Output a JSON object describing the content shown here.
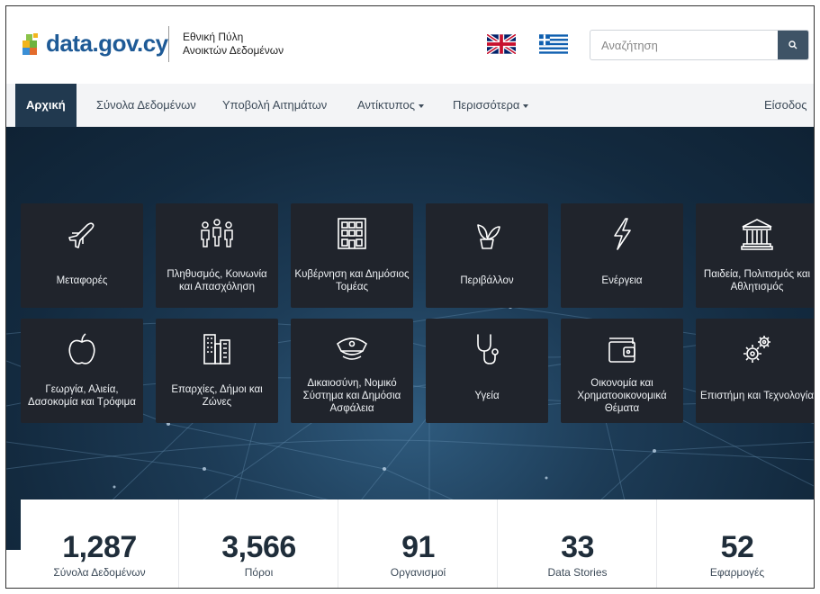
{
  "header": {
    "logo_text": "data.gov.cy",
    "subtitle_line1": "Εθνική Πύλη",
    "subtitle_line2": "Ανοικτών Δεδομένων",
    "search_placeholder": "Αναζήτηση"
  },
  "nav": {
    "items": [
      {
        "label": "Αρχική",
        "active": true
      },
      {
        "label": "Σύνολα Δεδομένων"
      },
      {
        "label": "Υποβολή Αιτημάτων"
      },
      {
        "label": "Αντίκτυπος",
        "dropdown": true
      },
      {
        "label": "Περισσότερα",
        "dropdown": true
      }
    ],
    "login": "Είσοδος"
  },
  "categories": [
    {
      "label": "Μεταφορές",
      "icon": "airplane-icon"
    },
    {
      "label": "Πληθυσμός, Κοινωνία και Απασχόληση",
      "icon": "people-icon"
    },
    {
      "label": "Κυβέρνηση και Δημόσιος Τομέας",
      "icon": "building-icon"
    },
    {
      "label": "Περιβάλλον",
      "icon": "plant-icon"
    },
    {
      "label": "Ενέργεια",
      "icon": "lightning-icon"
    },
    {
      "label": "Παιδεία, Πολιτισμός και Αθλητισμός",
      "icon": "museum-icon"
    },
    {
      "label": "Γεωργία, Αλιεία, Δασοκομία και Τρόφιμα",
      "icon": "apple-icon"
    },
    {
      "label": "Επαρχίες, Δήμοι και Ζώνες",
      "icon": "city-icon"
    },
    {
      "label": "Δικαιοσύνη, Νομικό Σύστημα και Δημόσια Ασφάλεια",
      "icon": "police-cap-icon"
    },
    {
      "label": "Υγεία",
      "icon": "stethoscope-icon"
    },
    {
      "label": "Οικονομία και Χρηματοοικονομικά Θέματα",
      "icon": "wallet-icon"
    },
    {
      "label": "Επιστήμη και Τεχνολογία",
      "icon": "gears-icon"
    }
  ],
  "stats": [
    {
      "value": "1,287",
      "label": "Σύνολα Δεδομένων"
    },
    {
      "value": "3,566",
      "label": "Πόροι"
    },
    {
      "value": "91",
      "label": "Οργανισμοί"
    },
    {
      "value": "33",
      "label": "Data Stories"
    },
    {
      "value": "52",
      "label": "Εφαρμογές"
    }
  ],
  "colors": {
    "brand_blue": "#1e5a96",
    "nav_active": "#21394f",
    "tile_bg": "#20242c",
    "search_button": "#3e5366"
  }
}
